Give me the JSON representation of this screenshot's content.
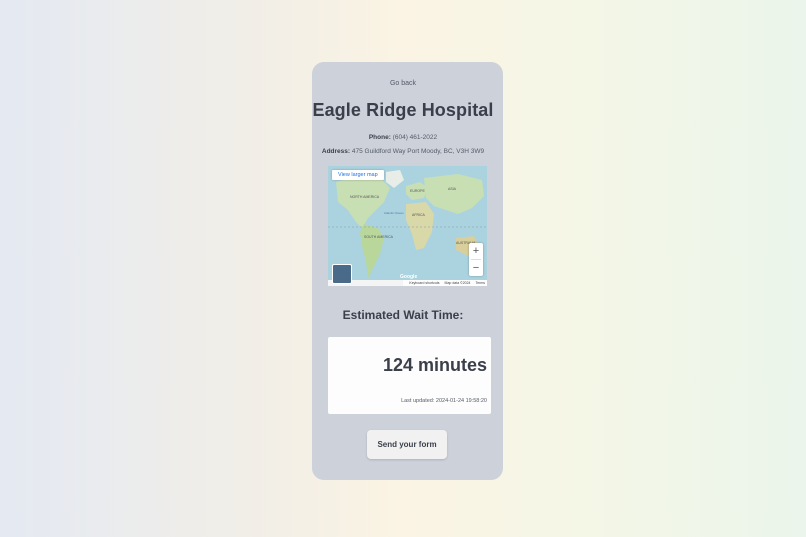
{
  "nav": {
    "go_back": "Go back"
  },
  "hospital": {
    "name": "Eagle Ridge Hospital",
    "phone_label": "Phone:",
    "phone": "(604) 461-2022",
    "address_label": "Address:",
    "address": "475 Guildford Way Port Moody, BC, V3H 3W9"
  },
  "map": {
    "view_larger": "View larger map",
    "zoom_in": "+",
    "zoom_out": "−",
    "logo": "Google",
    "keyboard": "Keyboard shortcuts",
    "map_data": "Map data ©2024",
    "terms": "Terms",
    "labels": {
      "north_america": "NORTH AMERICA",
      "south_america": "SOUTH AMERICA",
      "africa": "AFRICA",
      "europe": "EUROPE",
      "asia": "ASIA",
      "australia": "AUSTRALIA",
      "ocean": "Atlantic Ocean"
    }
  },
  "wait": {
    "label": "Estimated Wait Time:",
    "value": "124 minutes",
    "updated": "Last updated: 2024-01-24 19:58:20"
  },
  "actions": {
    "send_form": "Send your form"
  },
  "colors": {
    "card": "#ccd1da",
    "water": "#aad3df",
    "land": "#c8dfb4",
    "text": "#3b3f4a"
  }
}
